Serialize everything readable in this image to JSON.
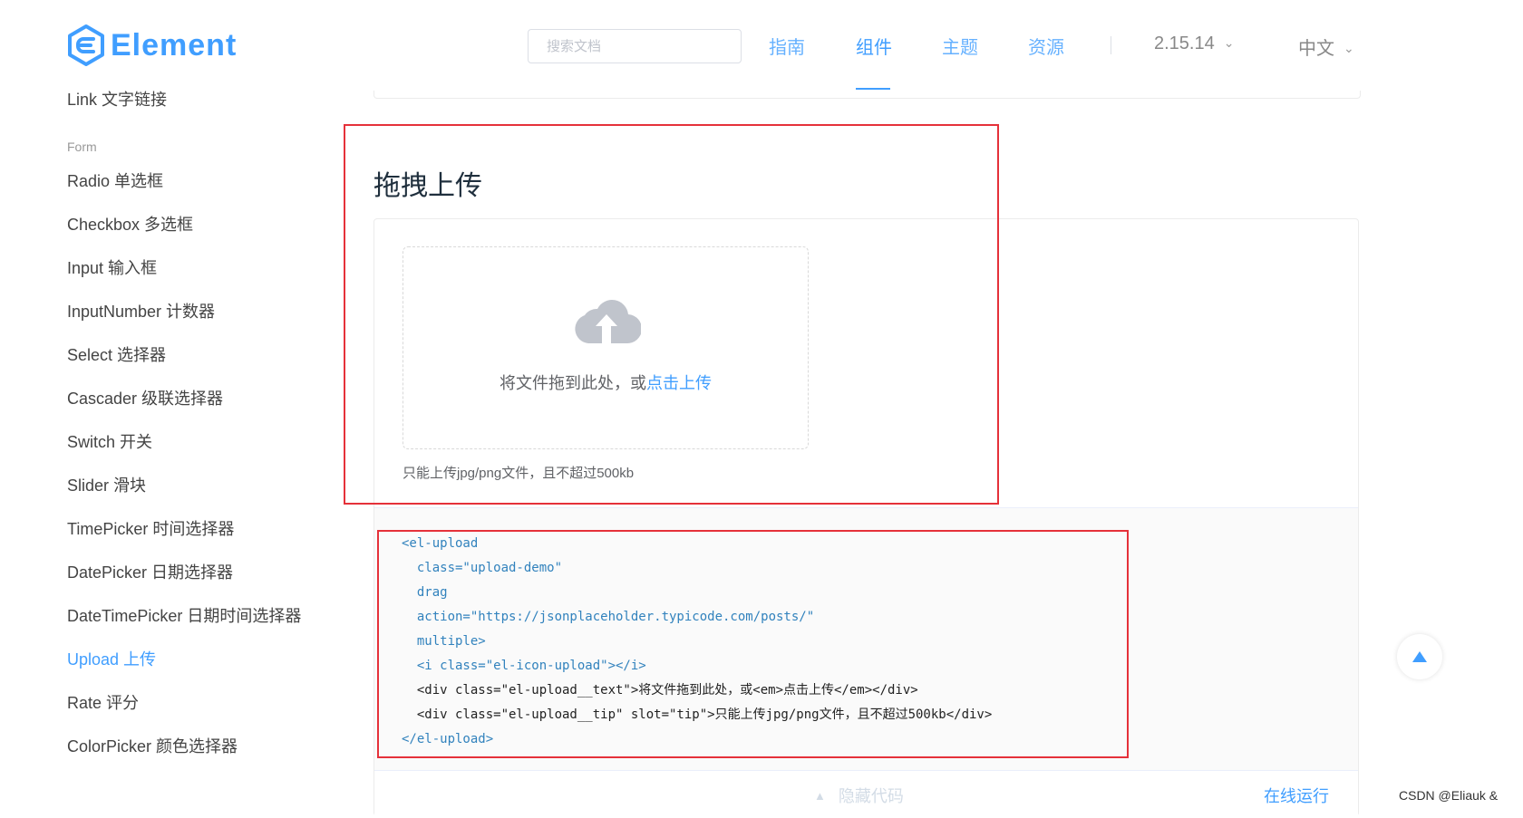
{
  "header": {
    "logo_text": "Element",
    "search_placeholder": "搜索文档",
    "nav": [
      "指南",
      "组件",
      "主题",
      "资源"
    ],
    "active_nav": "组件",
    "version": "2.15.14",
    "language": "中文"
  },
  "sidebar": {
    "partial_item": "Link 文字链接",
    "group": "Form",
    "items": [
      "Radio 单选框",
      "Checkbox 多选框",
      "Input 输入框",
      "InputNumber 计数器",
      "Select 选择器",
      "Cascader 级联选择器",
      "Switch 开关",
      "Slider 滑块",
      "TimePicker 时间选择器",
      "DatePicker 日期选择器",
      "DateTimePicker 日期时间选择器",
      "Upload 上传",
      "Rate 评分",
      "ColorPicker 颜色选择器"
    ],
    "active_item": "Upload 上传"
  },
  "demo": {
    "title": "拖拽上传",
    "upload_text_prefix": "将文件拖到此处，或",
    "upload_text_link": "点击上传",
    "upload_tip": "只能上传jpg/png文件，且不超过500kb",
    "code_lines": [
      "<el-upload",
      "  class=\"upload-demo\"",
      "  drag",
      "  action=\"https://jsonplaceholder.typicode.com/posts/\"",
      "  multiple>",
      "  <i class=\"el-icon-upload\"></i>",
      "  <div class=\"el-upload__text\">将文件拖到此处，或<em>点击上传</em></div>",
      "  <div class=\"el-upload__tip\" slot=\"tip\">只能上传jpg/png文件，且不超过500kb</div>",
      "</el-upload>"
    ],
    "hide_code": "隐藏代码",
    "run_online": "在线运行"
  },
  "watermark": "CSDN @Eliauk &",
  "colors": {
    "accent": "#409eff",
    "highlight_box": "#e5313a",
    "icon_gray": "#c0c4cc"
  },
  "icons": [
    "element-logo-icon",
    "chevron-down-icon",
    "upload-cloud-icon",
    "caret-up-icon",
    "back-to-top-icon"
  ]
}
